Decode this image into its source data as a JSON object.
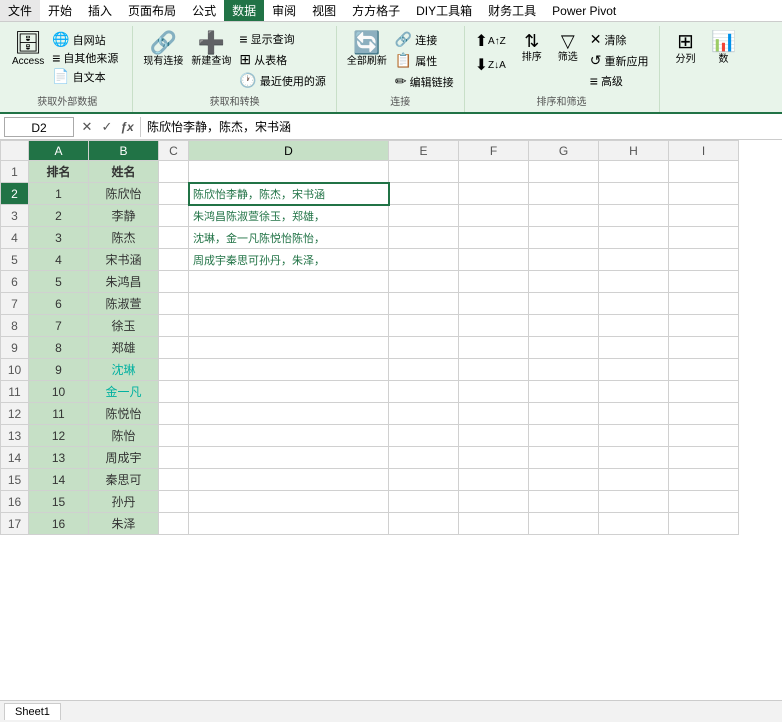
{
  "menubar": {
    "items": [
      "文件",
      "开始",
      "插入",
      "页面布局",
      "公式",
      "数据",
      "审阅",
      "视图",
      "方方格子",
      "DIY工具箱",
      "财务工具",
      "Power Pivot"
    ]
  },
  "ribbon": {
    "active_tab": "数据",
    "groups": [
      {
        "label": "获取外部数据",
        "buttons": [
          {
            "id": "access-btn",
            "icon": "🗄",
            "label": "Access"
          },
          {
            "id": "web-btn",
            "icon": "🌐",
            "label": "自网站"
          },
          {
            "id": "text-btn",
            "icon": "📄",
            "label": "自文本"
          }
        ],
        "extra_btn": {
          "id": "other-src-btn",
          "icon": "≡",
          "label": "自其他来源"
        }
      },
      {
        "label": "获取和转换",
        "buttons": [
          {
            "id": "existing-conn-btn",
            "icon": "🔗",
            "label": "现有连接"
          },
          {
            "id": "new-query-btn",
            "icon": "➕",
            "label": "新建查询"
          },
          {
            "id": "show-query-btn",
            "small": true,
            "icon": "≡",
            "label": "显示查询"
          },
          {
            "id": "from-table-btn",
            "small": true,
            "icon": "⊞",
            "label": "从表格"
          },
          {
            "id": "recent-src-btn",
            "small": true,
            "icon": "🕐",
            "label": "最近使用的源"
          }
        ]
      },
      {
        "label": "连接",
        "buttons": [
          {
            "id": "refresh-all-btn",
            "icon": "🔄",
            "label": "全部刷新"
          },
          {
            "id": "connect-btn",
            "small": true,
            "icon": "🔗",
            "label": "连接"
          },
          {
            "id": "property-btn",
            "small": true,
            "icon": "📋",
            "label": "属性"
          },
          {
            "id": "edit-link-btn",
            "small": true,
            "icon": "✏",
            "label": "编辑链接"
          }
        ]
      },
      {
        "label": "排序和筛选",
        "buttons": [
          {
            "id": "sort-asc-btn",
            "small": true,
            "icon": "↑A",
            "label": ""
          },
          {
            "id": "sort-desc-btn",
            "small": true,
            "icon": "↓Z",
            "label": ""
          },
          {
            "id": "sort-btn",
            "icon": "⇅",
            "label": "排序"
          },
          {
            "id": "filter-btn",
            "icon": "▽",
            "label": "筛选"
          },
          {
            "id": "clear-btn",
            "small": true,
            "icon": "✕",
            "label": "清除"
          },
          {
            "id": "reapply-btn",
            "small": true,
            "icon": "↺",
            "label": "重新应用"
          },
          {
            "id": "advanced-btn",
            "small": true,
            "icon": "≡",
            "label": "高级"
          }
        ]
      },
      {
        "label": "",
        "buttons": [
          {
            "id": "column-btn",
            "icon": "⊞",
            "label": "分列"
          },
          {
            "id": "data-num-btn",
            "icon": "📊",
            "label": "数"
          }
        ]
      }
    ]
  },
  "formula_bar": {
    "cell_ref": "D2",
    "formula": "陈欣怡李静，陈杰，宋书涵"
  },
  "sheet": {
    "col_headers": [
      "",
      "A",
      "B",
      "C",
      "D",
      "E",
      "F",
      "G",
      "H",
      "I"
    ],
    "rows": [
      {
        "row": "1",
        "A": "排名",
        "B": "姓名",
        "C": "",
        "D": "",
        "E": "",
        "F": "",
        "G": "",
        "H": "",
        "I": ""
      },
      {
        "row": "2",
        "A": "1",
        "B": "陈欣怡",
        "C": "",
        "D": "陈欣怡李静，陈杰，宋书涵",
        "E": "",
        "F": "",
        "G": "",
        "H": "",
        "I": ""
      },
      {
        "row": "3",
        "A": "2",
        "B": "李静",
        "C": "",
        "D": "朱鸿昌陈淑萱徐玉，郑雄，",
        "E": "",
        "F": "",
        "G": "",
        "H": "",
        "I": ""
      },
      {
        "row": "4",
        "A": "3",
        "B": "陈杰",
        "C": "",
        "D": "沈琳，金一凡陈悦怡陈怡，",
        "E": "",
        "F": "",
        "G": "",
        "H": "",
        "I": ""
      },
      {
        "row": "5",
        "A": "4",
        "B": "宋书涵",
        "C": "",
        "D": "周成宇秦思可孙丹，朱泽，",
        "E": "",
        "F": "",
        "G": "",
        "H": "",
        "I": ""
      },
      {
        "row": "6",
        "A": "5",
        "B": "朱鸿昌",
        "C": "",
        "D": "",
        "E": "",
        "F": "",
        "G": "",
        "H": "",
        "I": ""
      },
      {
        "row": "7",
        "A": "6",
        "B": "陈淑萱",
        "C": "",
        "D": "",
        "E": "",
        "F": "",
        "G": "",
        "H": "",
        "I": ""
      },
      {
        "row": "8",
        "A": "7",
        "B": "徐玉",
        "C": "",
        "D": "",
        "E": "",
        "F": "",
        "G": "",
        "H": "",
        "I": ""
      },
      {
        "row": "9",
        "A": "8",
        "B": "郑雄",
        "C": "",
        "D": "",
        "E": "",
        "F": "",
        "G": "",
        "H": "",
        "I": ""
      },
      {
        "row": "10",
        "A": "9",
        "B": "沈琳",
        "C": "",
        "D": "",
        "E": "",
        "F": "",
        "G": "",
        "H": "",
        "I": ""
      },
      {
        "row": "11",
        "A": "10",
        "B": "金一凡",
        "C": "",
        "D": "",
        "E": "",
        "F": "",
        "G": "",
        "H": "",
        "I": ""
      },
      {
        "row": "12",
        "A": "11",
        "B": "陈悦怡",
        "C": "",
        "D": "",
        "E": "",
        "F": "",
        "G": "",
        "H": "",
        "I": ""
      },
      {
        "row": "13",
        "A": "12",
        "B": "陈怡",
        "C": "",
        "D": "",
        "E": "",
        "F": "",
        "G": "",
        "H": "",
        "I": ""
      },
      {
        "row": "14",
        "A": "13",
        "B": "周成宇",
        "C": "",
        "D": "",
        "E": "",
        "F": "",
        "G": "",
        "H": "",
        "I": ""
      },
      {
        "row": "15",
        "A": "14",
        "B": "秦思可",
        "C": "",
        "D": "",
        "E": "",
        "F": "",
        "G": "",
        "H": "",
        "I": ""
      },
      {
        "row": "16",
        "A": "15",
        "B": "孙丹",
        "C": "",
        "D": "",
        "E": "",
        "F": "",
        "G": "",
        "H": "",
        "I": ""
      },
      {
        "row": "17",
        "A": "16",
        "B": "朱泽",
        "C": "",
        "D": "",
        "E": "",
        "F": "",
        "G": "",
        "H": "",
        "I": ""
      }
    ]
  },
  "sheet_tab": "Sheet1",
  "colors": {
    "accent": "#217346",
    "header_bg": "#c6e0c6",
    "teal_name": "#00b0a0",
    "dark_name": "#333333",
    "related_text": "#217346"
  }
}
